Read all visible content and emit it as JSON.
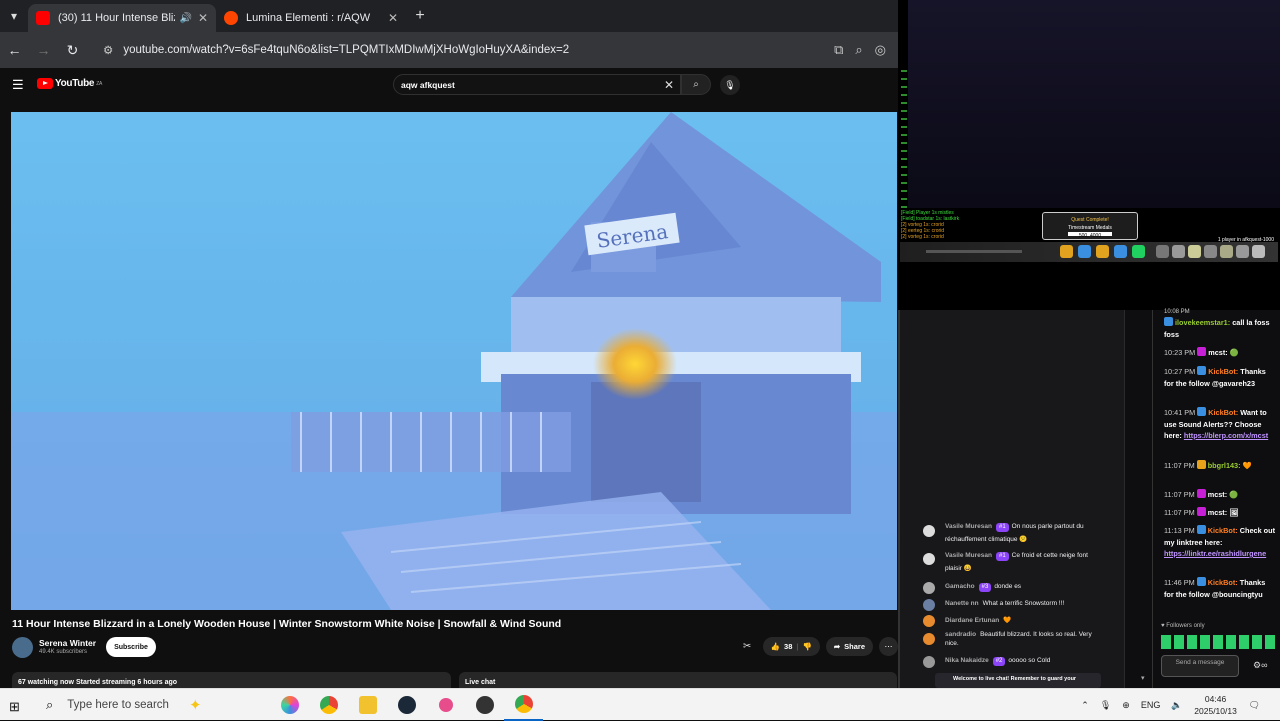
{
  "browser": {
    "tabs": [
      {
        "title": "(30) 11 Hour Intense Blizza",
        "active": true,
        "audio": true
      },
      {
        "title": "Lumina Elementi : r/AQW",
        "active": false
      }
    ],
    "url": "youtube.com/watch?v=6sFe4tquN6o&list=TLPQMTIxMDIwMjXHoWgIoHuyXA&index=2"
  },
  "youtube": {
    "logo_text": "YouTube",
    "country": "ZA",
    "search_query": "aqw afkquest",
    "video": {
      "sign_text": "Serena",
      "title": "11 Hour Intense Blizzard in a Lonely Wooden House | Winter Snowstorm White Noise | Snowfall & Wind Sound"
    },
    "channel": {
      "name": "Serena Winter",
      "subs": "49.4K subscribers",
      "subscribe_label": "Subscribe"
    },
    "likes": "38",
    "share_label": "Share",
    "stats_text": "67 watching now  Started streaming 6 hours ago",
    "livechat_label": "Live chat"
  },
  "game": {
    "log": [
      {
        "text": "[Field] Player 1s mistles",
        "color": "green"
      },
      {
        "text": "[Field] toadstar 1s: lastkirk",
        "color": "green"
      },
      {
        "text": "[2] vorteg 1s: crorid",
        "color": "red"
      },
      {
        "text": "[2] eerteg 1s: crorid",
        "color": "red"
      },
      {
        "text": "[2] vorteg 1s: crorid",
        "color": "red"
      }
    ],
    "quest_complete": {
      "header": "Quest Complete!",
      "name": "Timestream Medals",
      "reward": "500, 4000"
    },
    "player_label": "1 player in afkquest-1000"
  },
  "chat_left": [
    {
      "user": "Vasile Muresan",
      "badge": "#1",
      "text": "On nous parle partout du réchauffement climatique 😕",
      "avatar": "#ddd"
    },
    {
      "user": "Vasile Muresan",
      "badge": "#1",
      "text": "Ce froid et cette neige font plaisir 😄",
      "avatar": "#ddd"
    },
    {
      "user": "Gamacho",
      "badge": "#3",
      "text": "donde es",
      "avatar": "#aaa"
    },
    {
      "user": "Nanette nn",
      "badge": "",
      "text": "What a terrific Snowstorm !!!",
      "avatar": "#6b7fa3"
    },
    {
      "user": "Diardane Ertunan",
      "badge": "",
      "text": "🧡",
      "avatar": "#e88b2f"
    },
    {
      "user": "sandradio",
      "badge": "",
      "text": "Beautiful blizzard. It looks so real. Very nice.",
      "avatar": "#e88b2f"
    },
    {
      "user": "Nika Nakaidze",
      "badge": "#2",
      "text": "ooooo so Cold",
      "avatar": "#999"
    }
  ],
  "welcome_text": "Welcome to live chat! Remember to guard your",
  "chat_right": [
    {
      "time": "10:08 PM",
      "user": "",
      "user_color": "#fff",
      "text": ""
    },
    {
      "time": "",
      "user": "ilovekeemstar1:",
      "user_color": "#9acd32",
      "text": "call la foss foss"
    },
    {
      "time": "10:23 PM",
      "user": "mcst:",
      "user_color": "#fff",
      "text": "🟢"
    },
    {
      "time": "10:27 PM",
      "user": "KickBot:",
      "user_color": "#ff7f24",
      "text": "Thanks for the follow @gavareh23"
    },
    {
      "time": "10:41 PM",
      "user": "KickBot:",
      "user_color": "#ff7f24",
      "text": "Want to use Sound Alerts?? Choose here:",
      "link": "https://blerp.com/x/mcst"
    },
    {
      "time": "11:07 PM",
      "user": "bbgrl143:",
      "user_color": "#9acd32",
      "text": "🧡"
    },
    {
      "time": "11:07 PM",
      "user": "mcst:",
      "user_color": "#fff",
      "text": "🟢"
    },
    {
      "time": "11:07 PM",
      "user": "mcst:",
      "user_color": "#fff",
      "text": "🖼"
    },
    {
      "time": "11:13 PM",
      "user": "KickBot:",
      "user_color": "#ff7f24",
      "text": "Check out my linktree here:",
      "link": "https://linktr.ee/rashidlurgene"
    },
    {
      "time": "11:46 PM",
      "user": "KickBot:",
      "user_color": "#ff7f24",
      "text": "Thanks for the follow @bouncingtyu"
    }
  ],
  "followers_only": "Followers only",
  "send_placeholder": "Send a message",
  "taskbar": {
    "search_placeholder": "Type here to search",
    "lang": "ENG",
    "time": "04:46",
    "date": "2025/10/13"
  }
}
